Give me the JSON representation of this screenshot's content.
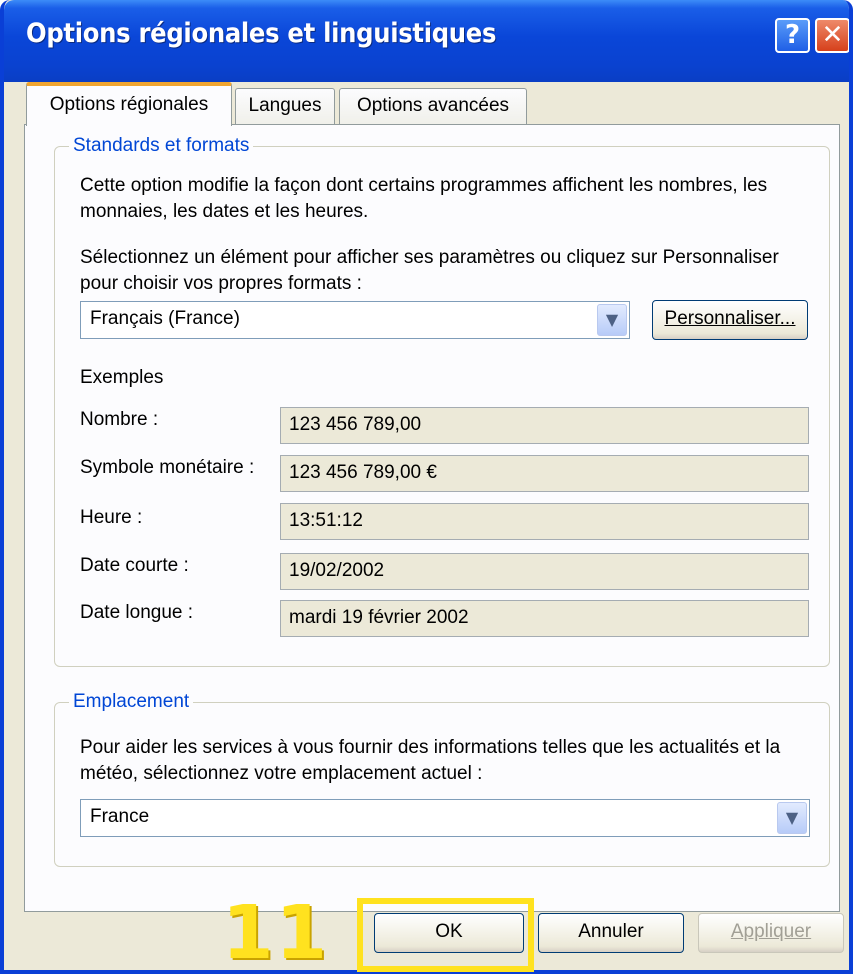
{
  "window": {
    "title": "Options régionales et linguistiques"
  },
  "titlebar_buttons": {
    "help": "?",
    "close": "✕"
  },
  "tabs": [
    {
      "label": "Options régionales",
      "active": true
    },
    {
      "label": "Langues",
      "active": false
    },
    {
      "label": "Options avancées",
      "active": false
    }
  ],
  "standards": {
    "legend": "Standards et formats",
    "description": "Cette option modifie la façon dont certains programmes affichent les nombres, les monnaies, les dates et les heures.",
    "instruction": "Sélectionnez un élément pour afficher ses paramètres ou cliquez sur Personnaliser pour choisir vos propres formats :",
    "locale_value": "Français (France)",
    "customize_label": "Personnaliser...",
    "examples_heading": "Exemples",
    "examples": [
      {
        "label": "Nombre :",
        "value": "123 456 789,00"
      },
      {
        "label": "Symbole monétaire :",
        "value": "123 456 789,00 €"
      },
      {
        "label": "Heure :",
        "value": "13:51:12"
      },
      {
        "label": "Date courte :",
        "value": "19/02/2002"
      },
      {
        "label": "Date longue :",
        "value": "mardi 19 février 2002"
      }
    ]
  },
  "location": {
    "legend": "Emplacement",
    "description": "Pour aider les services à vous fournir des informations telles que les actualités et la météo, sélectionnez votre emplacement actuel :",
    "value": "France"
  },
  "buttons": {
    "ok": "OK",
    "cancel": "Annuler",
    "apply": "Appliquer"
  },
  "annotation": {
    "step_number": "11"
  },
  "colors": {
    "titlebar": "#0a46d8",
    "dialog_bg": "#ece9d8",
    "legend_text": "#0046d5",
    "highlight": "#ffe21f",
    "active_tab_accent": "#f0a530"
  }
}
